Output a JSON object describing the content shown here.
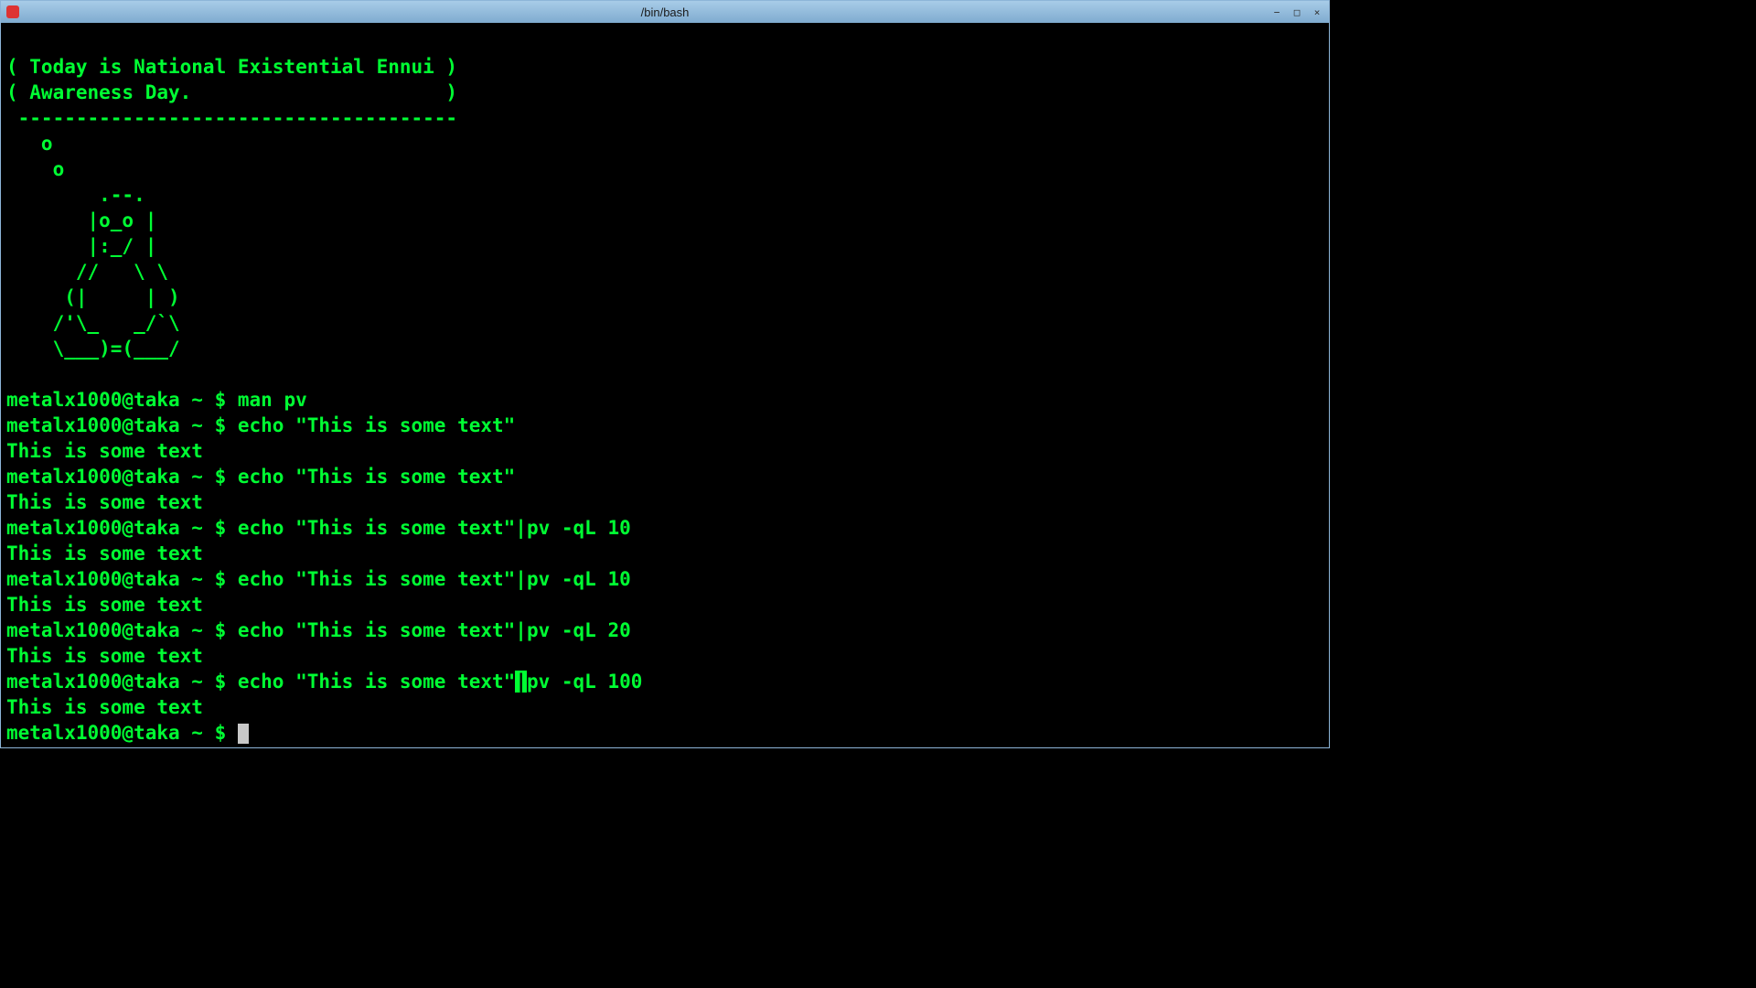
{
  "titlebar": {
    "title": "/bin/bash"
  },
  "ascii_art": {
    "line1": "( Today is National Existential Ennui )",
    "line2": "( Awareness Day.                      )",
    "line3": " --------------------------------------",
    "line4": "   o",
    "line5": "    o",
    "line6": "        .--.",
    "line7": "       |o_o |",
    "line8": "       |:_/ |",
    "line9": "      //   \\ \\",
    "line10": "     (|     | )",
    "line11": "    /'\\_   _/`\\",
    "line12": "    \\___)=(___/"
  },
  "prompt": {
    "user_host": "metalx1000@taka",
    "path": " ~ $ "
  },
  "commands": {
    "cmd1": "man pv",
    "cmd2": "echo \"This is some text\"",
    "cmd3": "echo \"This is some text\"",
    "cmd4": "echo \"This is some text\"|pv -qL 10",
    "cmd5": "echo \"This is some text\"|pv -qL 10",
    "cmd6": "echo \"This is some text\"|pv -qL 20",
    "cmd7_part1": "echo \"This is some text\"",
    "cmd7_pipe": "|",
    "cmd7_part2": "pv -qL 100"
  },
  "output": {
    "out1": "This is some text",
    "out2": "This is some text",
    "out3": "This is some text",
    "out4": "This is some text",
    "out5": "This is some text",
    "out6": "This is some text"
  }
}
